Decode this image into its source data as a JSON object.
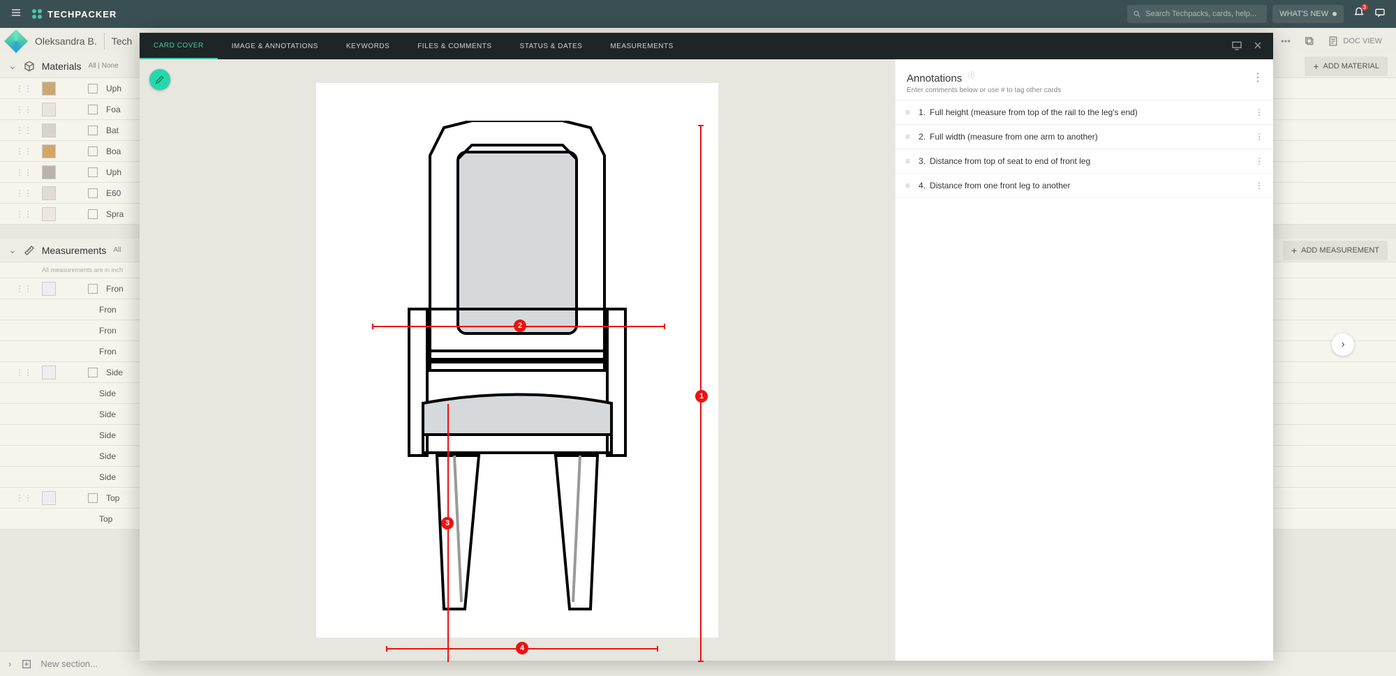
{
  "header": {
    "brand": "TECHPACKER",
    "search_placeholder": "Search Techpacks, cards, help...",
    "whats_new": "WHAT'S NEW",
    "notif_count": "3",
    "doc_view": "DOC VIEW"
  },
  "breadcrumb": {
    "user": "Oleksandra B.",
    "project": "Tech"
  },
  "sections": {
    "materials": {
      "title": "Materials",
      "filter": "All | None",
      "add_label": "ADD MATERIAL",
      "rows": [
        "Uph",
        "Foa",
        "Bat",
        "Boa",
        "Uph",
        "E60",
        "Spra"
      ]
    },
    "measurements": {
      "title": "Measurements",
      "filter": "All",
      "add_label": "ADD MEASUREMENT",
      "note": "All measurements are in inch",
      "rows": [
        "Fron",
        "Fron",
        "Fron",
        "Fron",
        "Side",
        "Side",
        "Side",
        "Side",
        "Side",
        "Side",
        "Top",
        "Top"
      ]
    },
    "new_section": "New section..."
  },
  "modal": {
    "tabs": [
      "CARD COVER",
      "IMAGE & ANNOTATIONS",
      "KEYWORDS",
      "FILES & COMMENTS",
      "STATUS & DATES",
      "MEASUREMENTS"
    ],
    "annotations": {
      "title": "Annotations",
      "subtitle": "Enter comments below or use # to tag other cards",
      "items": [
        {
          "n": "1.",
          "text": "Full height (measure from top of the rail to the leg's end)"
        },
        {
          "n": "2.",
          "text": "Full width (measure from one arm to another)"
        },
        {
          "n": "3.",
          "text": "Distance from top of seat to end of front leg"
        },
        {
          "n": "4.",
          "text": "Distance from one front leg to another"
        }
      ]
    },
    "markers": [
      "1",
      "2",
      "3",
      "4"
    ]
  }
}
